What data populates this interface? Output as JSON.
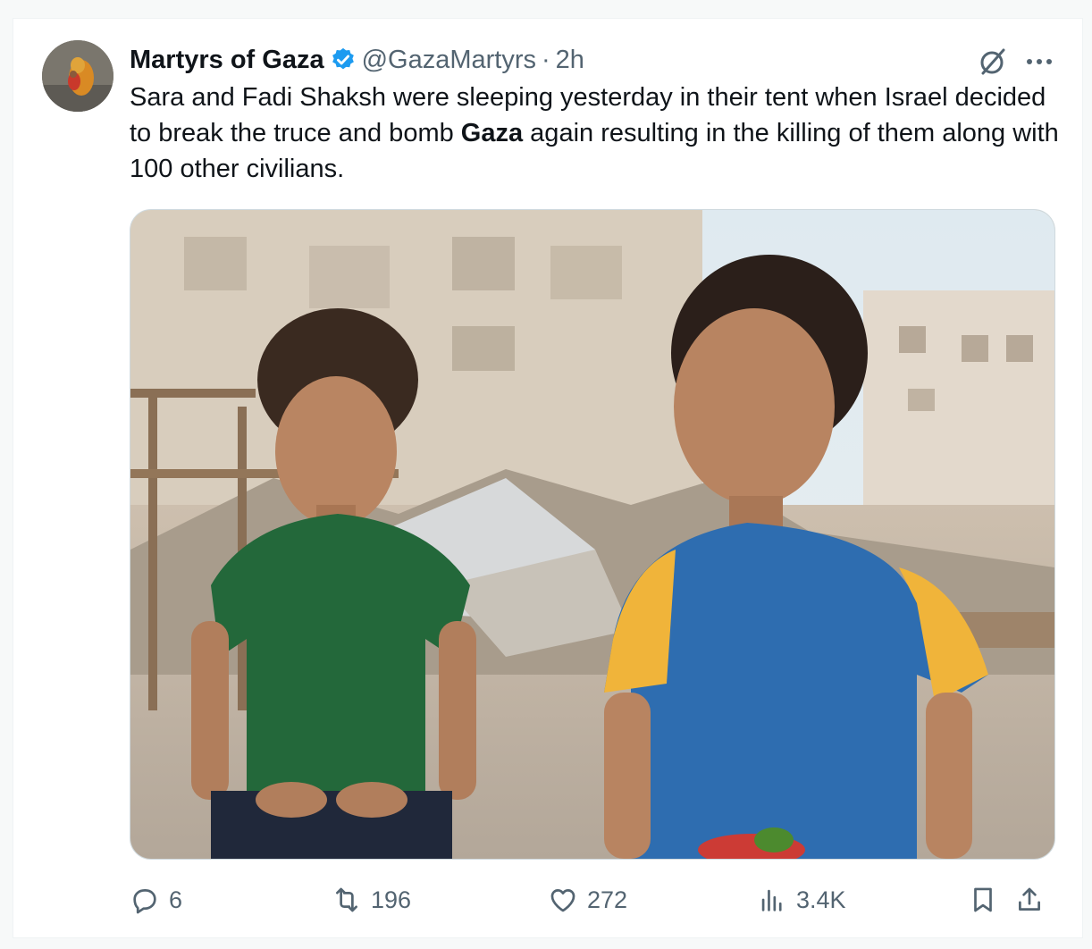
{
  "tweet": {
    "author_name": "Martyrs of Gaza",
    "handle": "@GazaMartyrs",
    "separator": "·",
    "time": "2h",
    "text_part1": "Sara and Fadi Shaksh were sleeping yesterday in their tent when Israel decided to break the truce and bomb ",
    "text_bold": "Gaza",
    "text_part2": " again resulting in the killing of them along with 100 other civilians.",
    "verified_color": "#1d9bf0"
  },
  "actions": {
    "replies": "6",
    "reposts": "196",
    "likes": "272",
    "views": "3.4K"
  },
  "icons": {
    "reply": "reply-icon",
    "repost": "repost-icon",
    "like": "heart-icon",
    "views": "analytics-icon",
    "bookmark": "bookmark-icon",
    "share": "share-icon",
    "grok": "grok-icon",
    "more": "more-icon",
    "verified": "verified-badge-icon"
  },
  "colors": {
    "text": "#0f1419",
    "muted": "#536471",
    "border": "#cfd9de"
  }
}
